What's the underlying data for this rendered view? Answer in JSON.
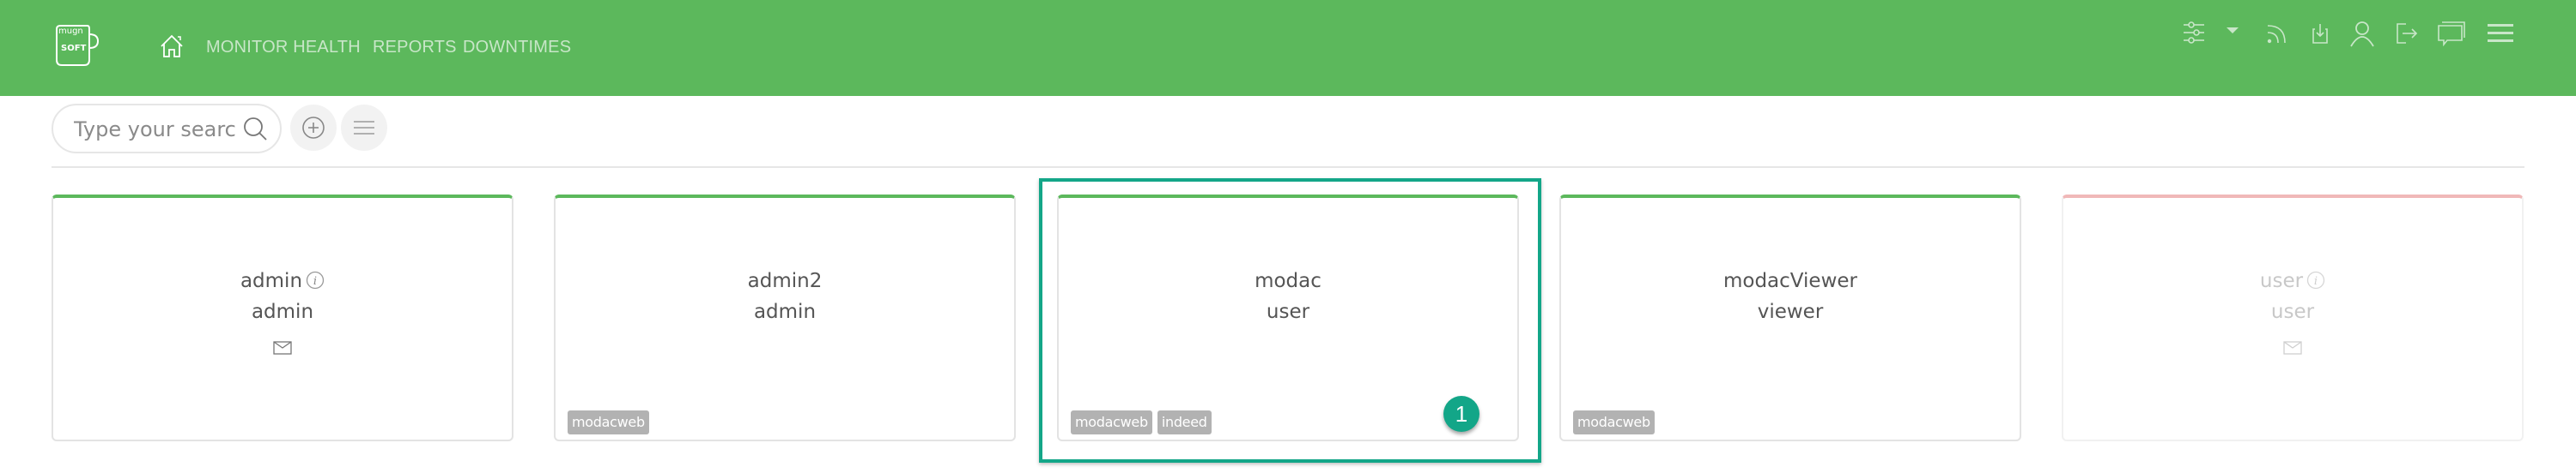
{
  "header": {
    "logo_text_top": "mugn",
    "logo_text_bottom": "SOFT",
    "nav": [
      {
        "label": "MONITOR HEALTH"
      },
      {
        "label": "REPORTS"
      },
      {
        "label": "DOWNTIMES"
      }
    ],
    "icons": [
      "home-icon",
      "sliders-icon",
      "dropdown-caret-icon",
      "rss-icon",
      "download-icon",
      "user-icon",
      "logout-icon",
      "chat-icon",
      "hamburger-menu-icon"
    ],
    "colors": {
      "background": "#5cb85c",
      "icon": "#c8e6c8"
    }
  },
  "toolbar": {
    "search_placeholder": "Type your search",
    "search_value": "",
    "add_button_icon": "plus-circle-icon",
    "list_button_icon": "list-icon"
  },
  "users": [
    {
      "name": "admin",
      "role": "admin",
      "has_info": true,
      "has_mail": true,
      "tags": [],
      "status": "active",
      "status_color": "#5cb85c"
    },
    {
      "name": "admin2",
      "role": "admin",
      "has_info": false,
      "has_mail": false,
      "tags": [
        "modacweb"
      ],
      "status": "active",
      "status_color": "#5cb85c"
    },
    {
      "name": "modac",
      "role": "user",
      "has_info": false,
      "has_mail": false,
      "tags": [
        "modacweb",
        "indeed"
      ],
      "status": "active",
      "status_color": "#5cb85c"
    },
    {
      "name": "modacViewer",
      "role": "viewer",
      "has_info": false,
      "has_mail": false,
      "tags": [
        "modacweb"
      ],
      "status": "active",
      "status_color": "#5cb85c"
    },
    {
      "name": "user",
      "role": "user",
      "has_info": true,
      "has_mail": true,
      "tags": [],
      "status": "disabled",
      "status_color": "#f0b8b8"
    }
  ],
  "annotation": {
    "step_number": "1",
    "highlighted_user": "modac",
    "color": "#13a688"
  }
}
